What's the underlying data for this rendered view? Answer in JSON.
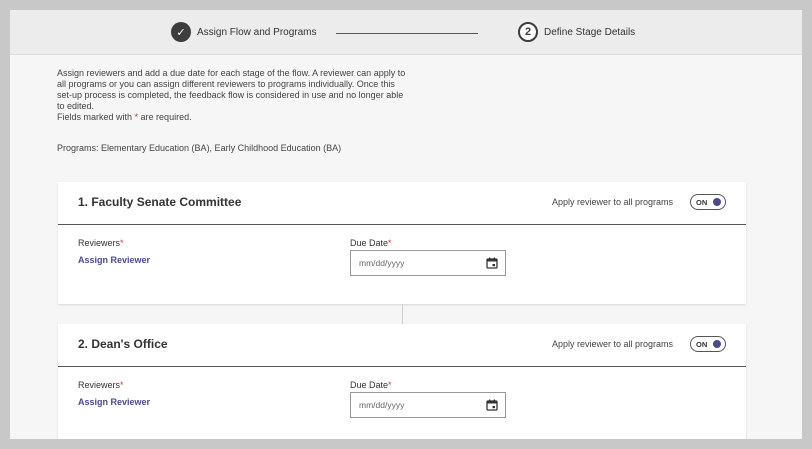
{
  "stepper": {
    "step1": {
      "icon": "checkmark-icon",
      "check_glyph": "✓",
      "label": "Assign Flow and Programs"
    },
    "step2": {
      "number": "2",
      "label": "Define Stage Details"
    }
  },
  "intro": {
    "line1": "Assign reviewers and add a due date for each stage of the flow. A reviewer can apply to",
    "line2": "all programs or you can assign different reviewers to programs individually. Once this",
    "line3": "set-up process is completed, the feedback flow is considered in use and no longer able",
    "line4": "to edited.",
    "required_prefix": "Fields marked with ",
    "required_star": "*",
    "required_suffix": " are required."
  },
  "programs": "Programs: Elementary Education (BA), Early Childhood Education (BA)",
  "stages": [
    {
      "title": "1. Faculty Senate Committee",
      "apply_label": "Apply reviewer to all programs",
      "toggle": "ON",
      "reviewers_label": "Reviewers",
      "assign_label": "Assign Reviewer",
      "due_label": "Due Date",
      "date_placeholder": "mm/dd/yyyy"
    },
    {
      "title": "2. Dean's Office",
      "apply_label": "Apply reviewer to all programs",
      "toggle": "ON",
      "reviewers_label": "Reviewers",
      "assign_label": "Assign Reviewer",
      "due_label": "Due Date",
      "date_placeholder": "mm/dd/yyyy"
    }
  ],
  "required_star": "*",
  "colors": {
    "accent": "#4b4a8f",
    "required": "#d9363e",
    "background": "#f6f6f6"
  }
}
